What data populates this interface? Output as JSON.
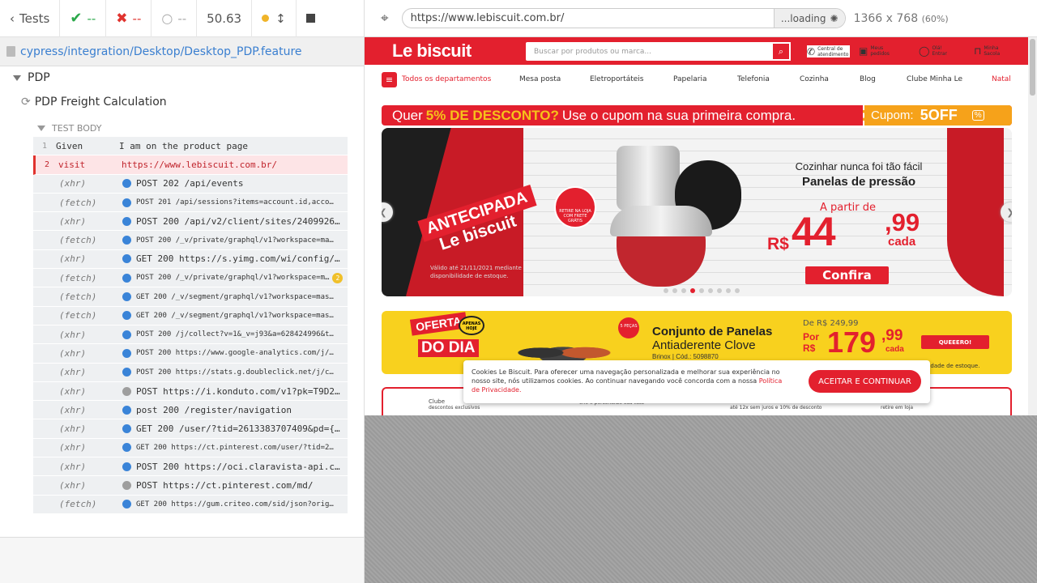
{
  "reporter": {
    "back_label": "Tests",
    "passed": "--",
    "failed": "--",
    "pending": "--",
    "duration": "50.63",
    "spec_path": "cypress/integration/Desktop/Desktop_PDP.feature",
    "suite": "PDP",
    "test": "PDP Freight Calculation",
    "body_label": "TEST BODY",
    "commands": [
      {
        "num": "1",
        "name": "Given",
        "msg": "I am on the product page"
      },
      {
        "num": "2",
        "name": "visit",
        "msg": "https://www.lebiscuit.com.br/"
      },
      {
        "name": "(xhr)",
        "msg": "POST 202 /api/events"
      },
      {
        "name": "(fetch)",
        "msg": "POST 201 /api/sessions?items=account.id,acco…"
      },
      {
        "name": "(xhr)",
        "msg": "POST 200 /api/v2/client/sites/2409926…"
      },
      {
        "name": "(fetch)",
        "msg": "POST 200 /_v/private/graphql/v1?workspace=ma…"
      },
      {
        "name": "(xhr)",
        "msg": "GET 200 https://s.yimg.com/wi/config/…"
      },
      {
        "name": "(fetch)",
        "msg": "POST 200 /_v/private/graphql/v1?workspace=m…",
        "badge": "2"
      },
      {
        "name": "(fetch)",
        "msg": "GET 200 /_v/segment/graphql/v1?workspace=mas…"
      },
      {
        "name": "(fetch)",
        "msg": "GET 200 /_v/segment/graphql/v1?workspace=mas…"
      },
      {
        "name": "(xhr)",
        "msg": "POST 200 /j/collect?v=1&_v=j93&a=628424996&t…"
      },
      {
        "name": "(xhr)",
        "msg": "POST 200 https://www.google-analytics.com/j/…"
      },
      {
        "name": "(xhr)",
        "msg": "POST 200 https://stats.g.doubleclick.net/j/c…"
      },
      {
        "name": "(xhr)",
        "msg": "POST https://i.konduto.com/v1?pk=T9D2…"
      },
      {
        "name": "(xhr)",
        "msg": "post 200 /register/navigation"
      },
      {
        "name": "(xhr)",
        "msg": "GET 200 /user/?tid=2613383707409&pd={…"
      },
      {
        "name": "(xhr)",
        "msg": "GET 200 https://ct.pinterest.com/user/?tid=2…"
      },
      {
        "name": "(xhr)",
        "msg": "POST 200 https://oci.claravista-api.c…"
      },
      {
        "name": "(xhr)",
        "msg": "POST https://ct.pinterest.com/md/"
      },
      {
        "name": "(fetch)",
        "msg": "GET 200 https://gum.criteo.com/sid/json?orig…"
      }
    ]
  },
  "browser": {
    "url": "https://www.lebiscuit.com.br/",
    "loading": "...loading",
    "viewport": "1366 x 768",
    "zoom": "(60%)"
  },
  "site": {
    "logo": "Le biscuit",
    "search_placeholder": "Buscar por produtos ou marca...",
    "header_links": [
      "Central de atendimento",
      "Meus pedidos",
      "Olá! Entrar",
      "Minha Sacola"
    ],
    "nav_all": "Todos os departamentos",
    "nav": [
      "Mesa posta",
      "Eletroportáteis",
      "Papelaria",
      "Telefonia",
      "Cozinha",
      "Blog",
      "Clube Minha Le",
      "Natal"
    ],
    "promo_pre": "Quer",
    "promo_bold": "5% DE DESCONTO?",
    "promo_post": "Use o cupom na sua primeira compra.",
    "coupon_label": "Cupom:",
    "coupon_code": "5OFF",
    "banner": {
      "antecipada": "ANTECIPADA",
      "logo2": "Le biscuit",
      "valid": "Válido até 21/11/2021 mediante disponibilidade de estoque.",
      "circle": "RETIRE NA LOJA COM FRETE GRÁTIS",
      "cook": "Cozinhar nunca foi tão fácil",
      "cook_bold": "Panelas de pressão",
      "apartir": "A partir de",
      "rs": "R$",
      "big": "44",
      "cents": ",99",
      "cada": "cada",
      "confira": "Confira"
    },
    "oferta": {
      "badge": "OFERTA",
      "apenas": "APENAS HOJE",
      "dodia": "DO DIA",
      "pecas": "5 PEÇAS",
      "title": "Conjunto de Panelas",
      "sub": "Antiaderente Clove",
      "brand": "Brinox | Cód.: 5098870",
      "de": "De R$ 249,99",
      "por": "Por R$",
      "v": "179",
      "c": ",99",
      "cada": "cada",
      "btn": "QUEEERO!",
      "disp": "ponibilidade de estoque."
    },
    "bottom": [
      "Clube",
      "descontos exclusivos",
      "crie e personalize sua lista",
      "até 12x sem juros e 10% de desconto",
      "retire em loja"
    ],
    "cookie_text": "Cookies Le Biscuit. Para oferecer uma navegação personalizada e melhorar sua experiência no nosso site, nós utilizamos cookies. Ao continuar navegando você concorda com a nossa",
    "cookie_link": "Política de Privacidade.",
    "cookie_btn": "ACEITAR E CONTINUAR"
  }
}
